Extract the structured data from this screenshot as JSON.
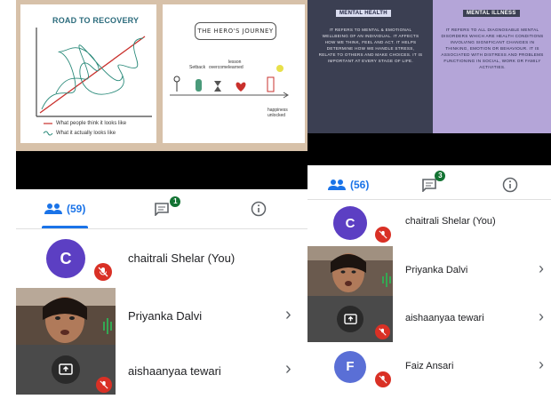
{
  "left": {
    "slide": {
      "road_title": "ROAD TO RECOVERY",
      "legend_people": "What people think it looks like",
      "legend_actual": "What it actually looks like",
      "hero_title": "THE HERO'S JOURNEY",
      "hero_labels": [
        "Setback",
        "overcome",
        "lesson learned"
      ],
      "hero_end": "happiness unlocked"
    },
    "tabs": {
      "people_count": "(59)",
      "chat_badge": "1"
    },
    "participants": [
      {
        "initial": "C",
        "name": "chaitrali Shelar (You)",
        "avatar_color": "#5c3fc3"
      },
      {
        "name": "Priyanka Dalvi"
      },
      {
        "name": "aishaanyaa tewari"
      }
    ]
  },
  "right": {
    "slide": {
      "health_head": "MENTAL HEALTH",
      "health_body": "IT REFERS TO MENTAL & EMOTIONAL WELLBEING OF AN INDIVIDUAL. IT AFFECTS HOW WE THINK, FEEL AND ACT. IT HELPS DETERMINE HOW WE HANDLE STRESS, RELATE TO OTHERS AND MAKE CHOICES. IT IS IMPORTANT AT EVERY STAGE OF LIFE.",
      "illness_head": "MENTAL ILLNESS",
      "illness_body": "IT REFERS TO ALL DIAGNOSABLE MENTAL DISORDERS WHICH ARE HEALTH CONDITIONS INVOLVING SIGNIFICANT CHANGES IN THINKING, EMOTION OR BEHAVIOUR. IT IS ASSOCIATED WITH DISTRESS AND PROBLEMS FUNCTIONING IN SOCIAL, WORK OR FAMILY ACTIVITIES."
    },
    "tabs": {
      "people_count": "(56)",
      "chat_badge": "3"
    },
    "participants": [
      {
        "initial": "C",
        "name": "chaitrali Shelar (You)",
        "avatar_color": "#5c3fc3"
      },
      {
        "name": "Priyanka Dalvi"
      },
      {
        "name": "aishaanyaa tewari"
      },
      {
        "initial": "F",
        "name": "Faiz Ansari",
        "avatar_color": "#5a6fd6"
      }
    ]
  },
  "icons": {
    "people": "people-icon",
    "chat": "chat-icon",
    "info": "info-icon",
    "mic_off": "mic-off-icon",
    "present": "present-screen-icon",
    "chevron": "chevron-right-icon"
  },
  "colors": {
    "accent": "#1a73e8",
    "mic_off": "#d93025",
    "badge": "#137333"
  }
}
